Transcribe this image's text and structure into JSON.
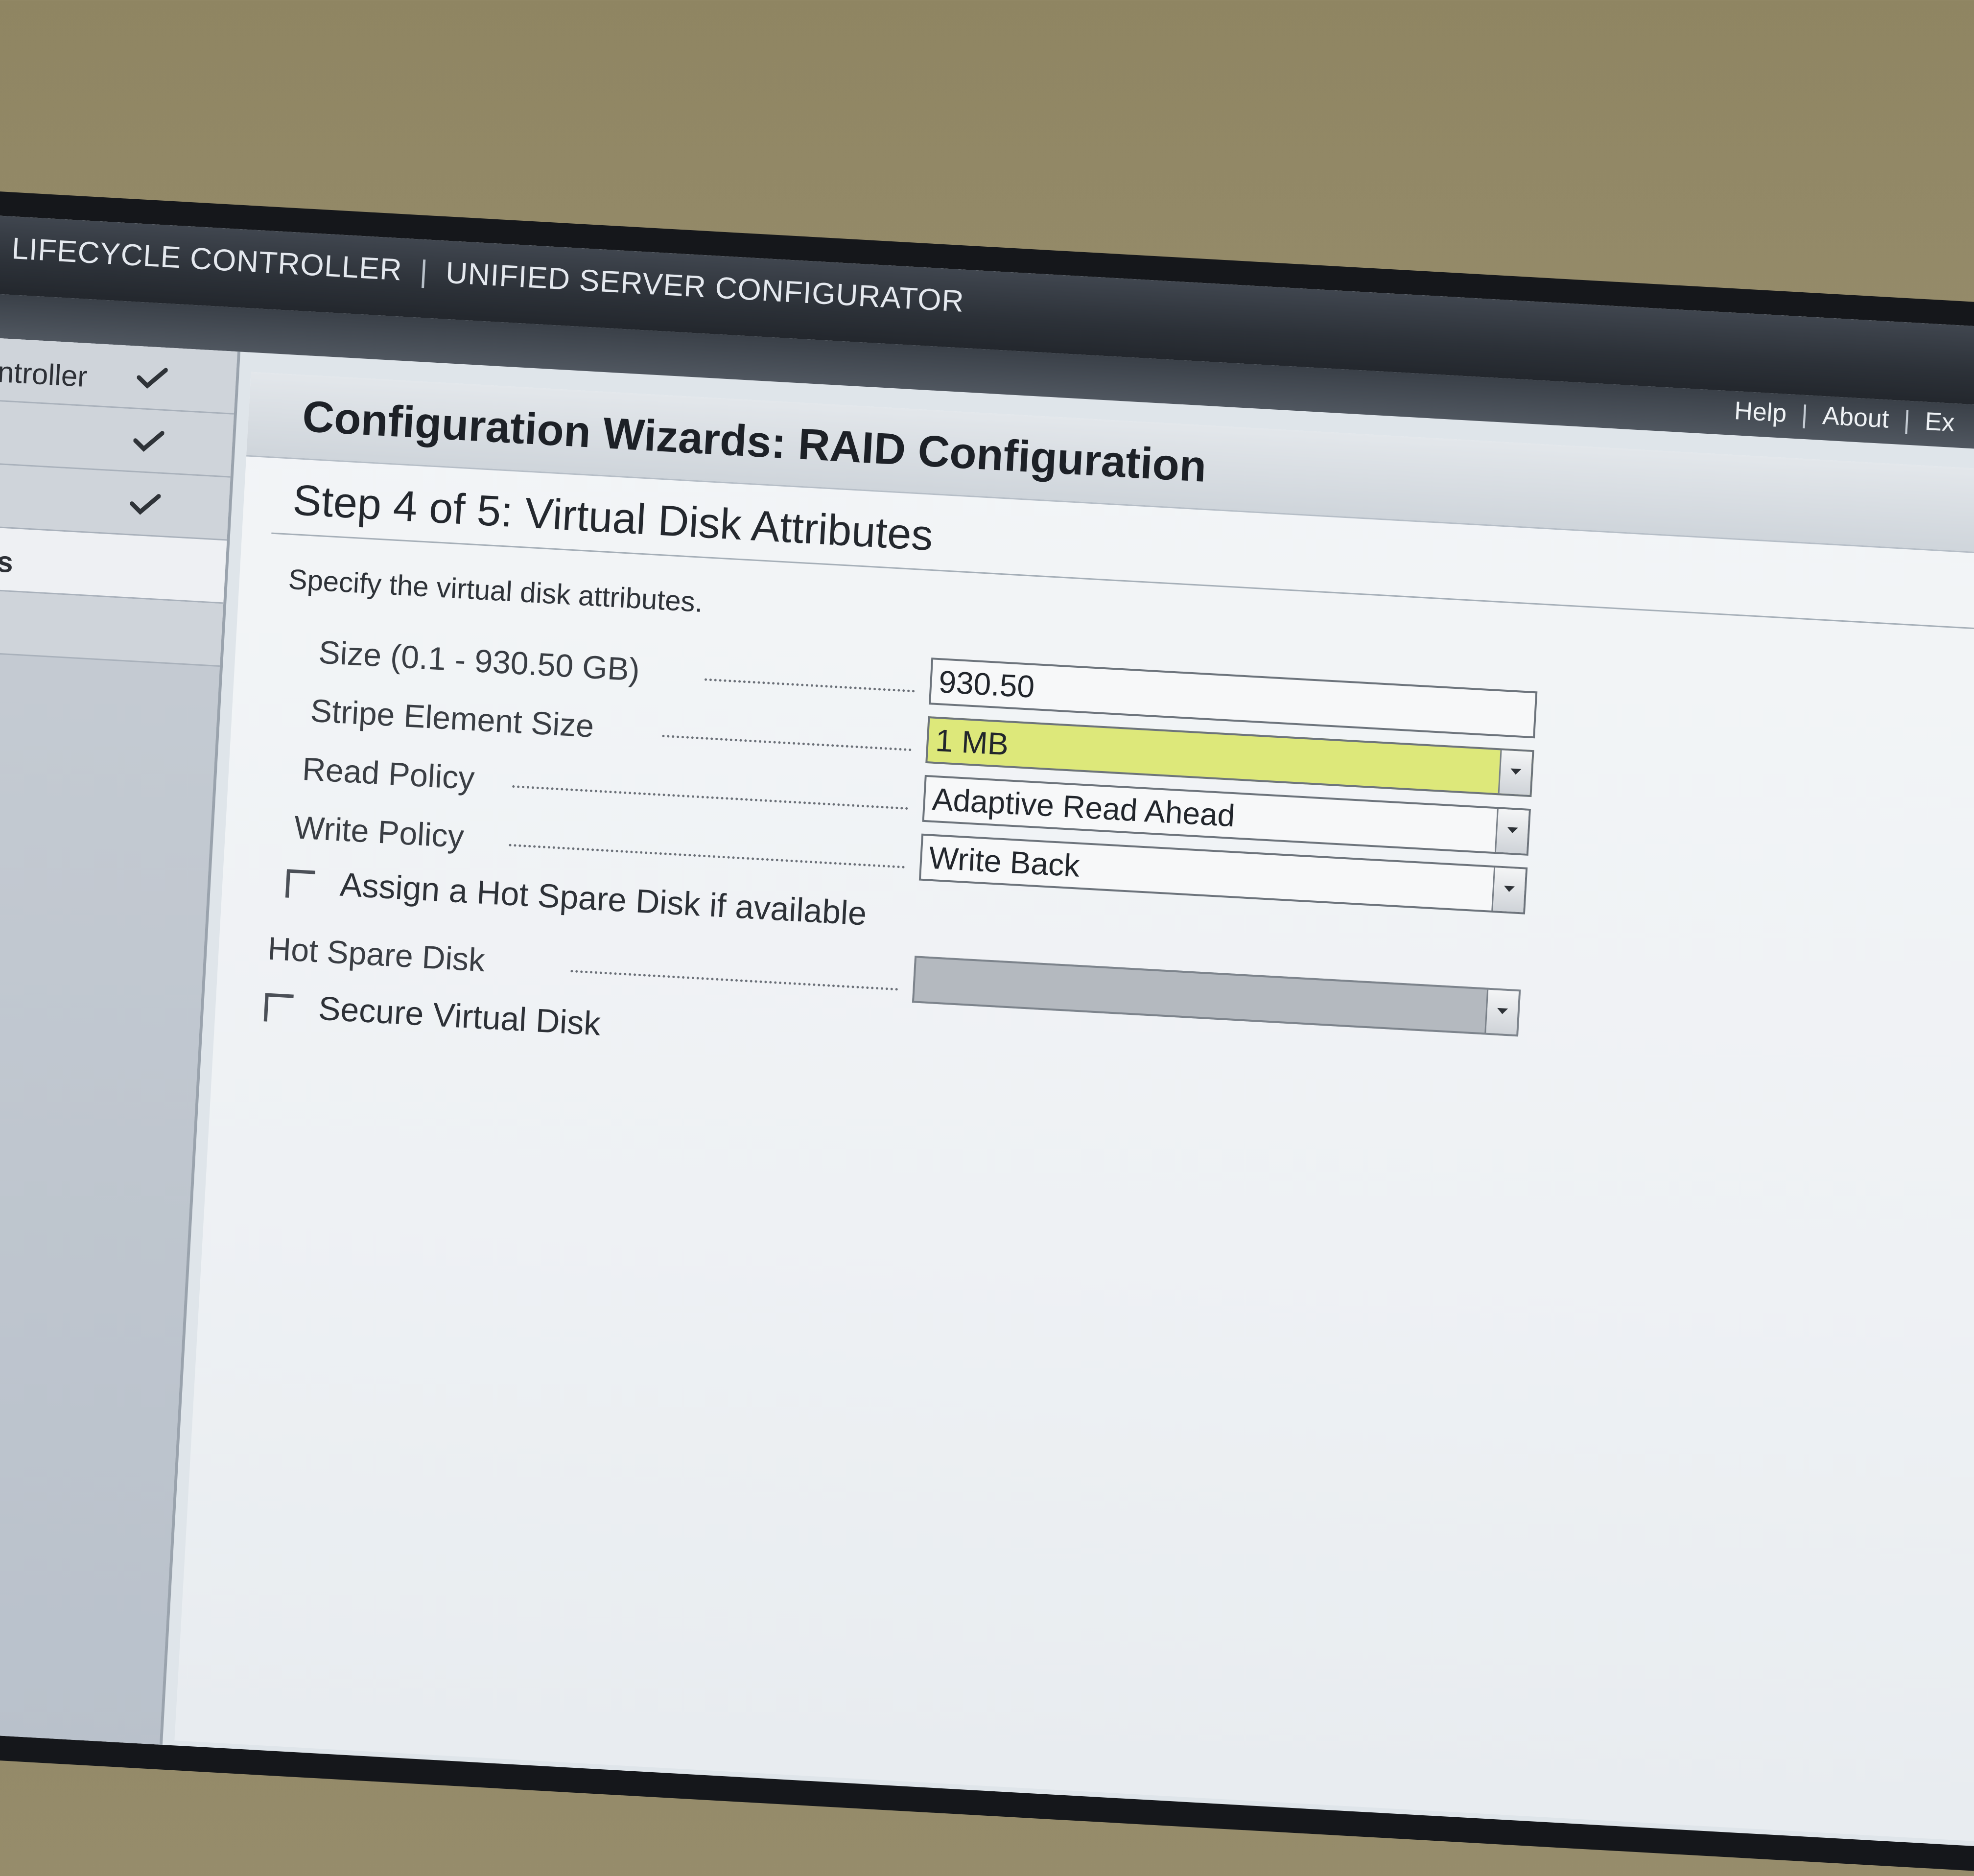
{
  "header": {
    "product": "LIFECYCLE CONTROLLER",
    "separator": "|",
    "subtitle": "UNIFIED SERVER CONFIGURATOR",
    "links": [
      "Help",
      "About",
      "Ex"
    ]
  },
  "sidebar": {
    "items": [
      {
        "label": "ontroller",
        "checked": true
      },
      {
        "label": "",
        "checked": true
      },
      {
        "label": "",
        "checked": true
      },
      {
        "label": "tes",
        "checked": false,
        "current": true
      },
      {
        "label": "",
        "checked": false
      }
    ]
  },
  "panel": {
    "title": "Configuration Wizards: RAID Configuration",
    "step": "Step 4 of 5: Virtual Disk Attributes",
    "instruction": "Specify the virtual disk attributes."
  },
  "form": {
    "size": {
      "label": "Size (0.1 - 930.50 GB)",
      "value": "930.50"
    },
    "stripe": {
      "label": "Stripe Element Size",
      "value": "1 MB"
    },
    "read_policy": {
      "label": "Read Policy",
      "value": "Adaptive Read Ahead"
    },
    "write_policy": {
      "label": "Write Policy",
      "value": "Write Back"
    },
    "assign_hot_spare": {
      "label": "Assign a Hot Spare Disk if available",
      "checked": false
    },
    "hot_spare_disk": {
      "label": "Hot Spare Disk",
      "value": ""
    },
    "secure_virtual_disk": {
      "label": "Secure Virtual Disk",
      "checked": false
    }
  },
  "colors": {
    "header_bg": "#2c3138",
    "highlight_field": "#dde87a",
    "disabled_field": "#b4b9bf"
  }
}
